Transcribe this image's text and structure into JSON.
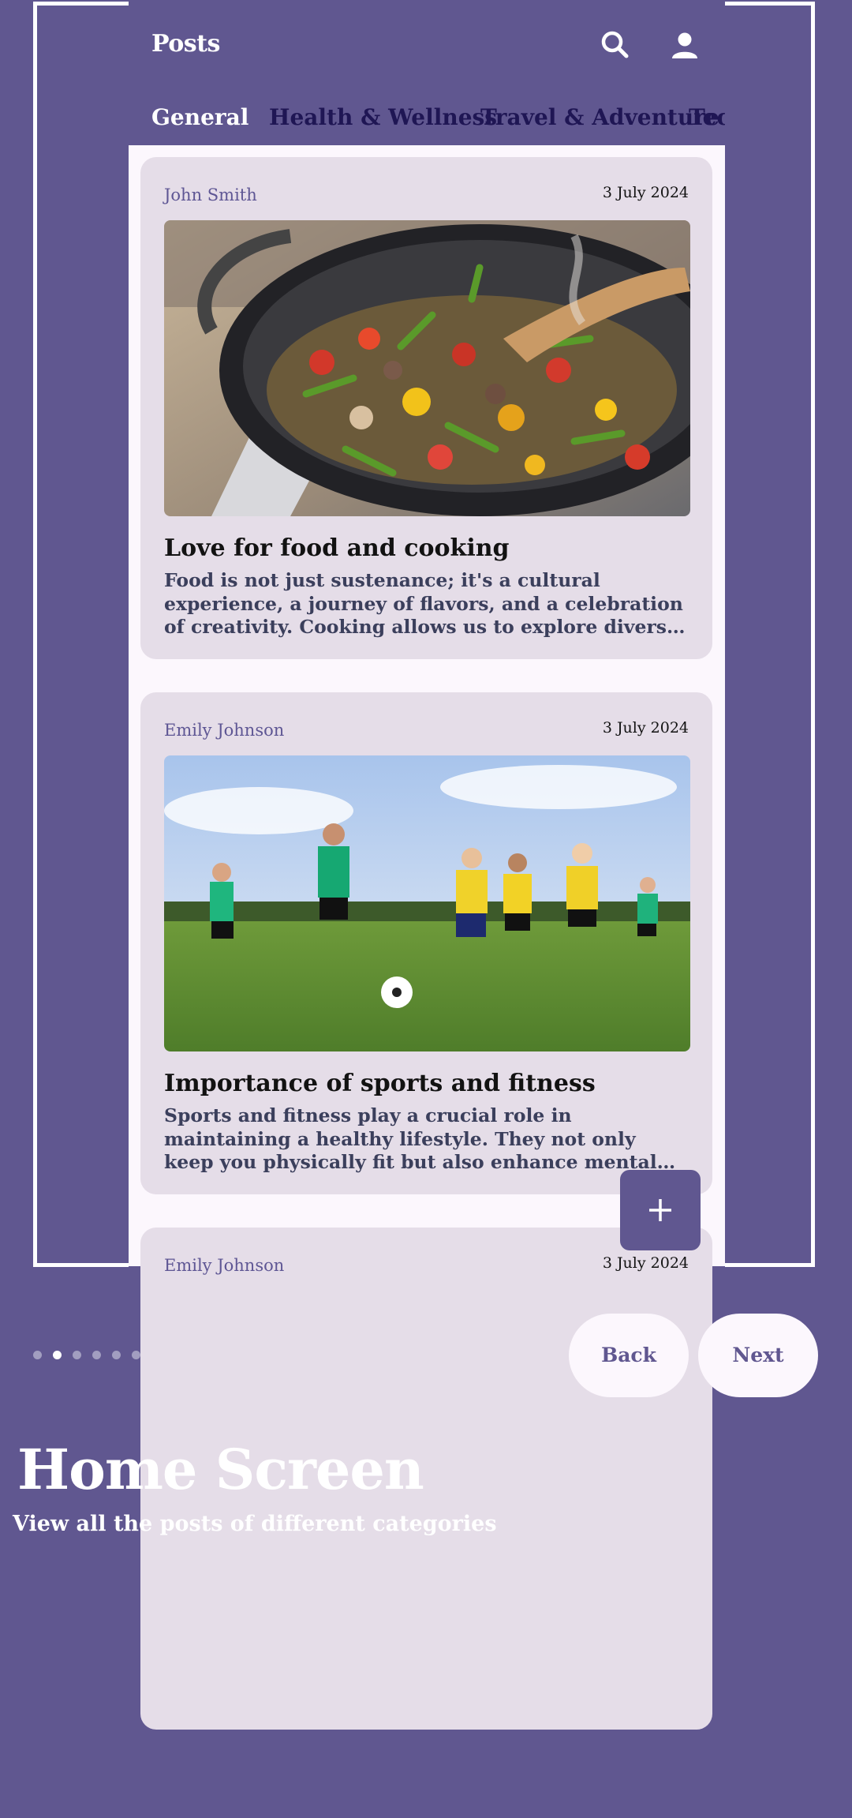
{
  "appbar": {
    "title": "Posts",
    "search_icon": "search-icon",
    "account_icon": "account-icon"
  },
  "tabs": [
    {
      "label": "General",
      "selected": true
    },
    {
      "label": "Health & Wellness",
      "selected": false
    },
    {
      "label": "Travel & Adventure",
      "selected": false
    },
    {
      "label": "Tech",
      "selected": false
    }
  ],
  "posts": [
    {
      "author": "John Smith",
      "date": "3 July 2024",
      "title": "Love for food and cooking",
      "body": "Food is not just sustenance; it's a cultural experience, a journey of flavors, and a celebration of creativity. Cooking allows us to explore diverse cuisines, experimenting with new ingredients and techniques."
    },
    {
      "author": "Emily Johnson",
      "date": "3 July 2024",
      "title": "Importance of sports and fitness",
      "body": "Sports and fitness play a crucial role in maintaining a healthy lifestyle. They not only keep you physically fit but also enhance mental well-being. Whether you're playing a team sport or training alone."
    },
    {
      "author": "Emily Johnson",
      "date": "3 July 2024",
      "title": "",
      "body": ""
    }
  ],
  "fab": {
    "icon": "plus-icon"
  },
  "pager": {
    "total": 6,
    "active_index": 1
  },
  "buttons": {
    "back": "Back",
    "next": "Next"
  },
  "screen": {
    "heading": "Home Screen",
    "subtitle": "View all the posts of different categories"
  },
  "colors": {
    "primary": "#605790",
    "surface": "#fcf7fd",
    "card": "#e5dde8",
    "tab_text": "#1f1654"
  }
}
